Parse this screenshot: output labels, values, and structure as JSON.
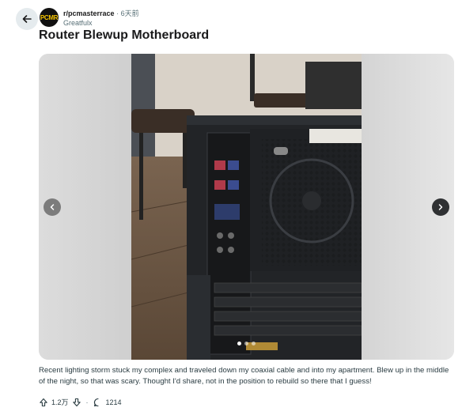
{
  "header": {
    "subreddit": "r/pcmasterrace",
    "separator": "·",
    "age": "6天前",
    "username": "Greatfulx",
    "avatar_text": "PCMR"
  },
  "post": {
    "title": "Router Blewup Motherboard",
    "body": "Recent lighting storm stuck my complex and traveled down my coaxial cable and into my apartment. Blew up in the middle of the night, so that was scary. Thought I'd share, not in the position to rebuild so there that I guess!"
  },
  "gallery": {
    "slide_count": 3,
    "active_slide": 1
  },
  "actions": {
    "vote_count": "1.2万",
    "separator": "·",
    "comment_count": "1214"
  },
  "icons": {
    "back": "arrow-left-icon",
    "prev": "chevron-left-icon",
    "next": "chevron-right-icon",
    "upvote": "upvote-arrow-icon",
    "downvote": "downvote-arrow-icon",
    "comments": "comment-bubble-icon"
  },
  "colors": {
    "back_bg": "#e5ebee",
    "avatar_bg": "#111111",
    "avatar_fg": "#f5c400",
    "text": "#1a1a1b",
    "muted": "#576f76"
  }
}
